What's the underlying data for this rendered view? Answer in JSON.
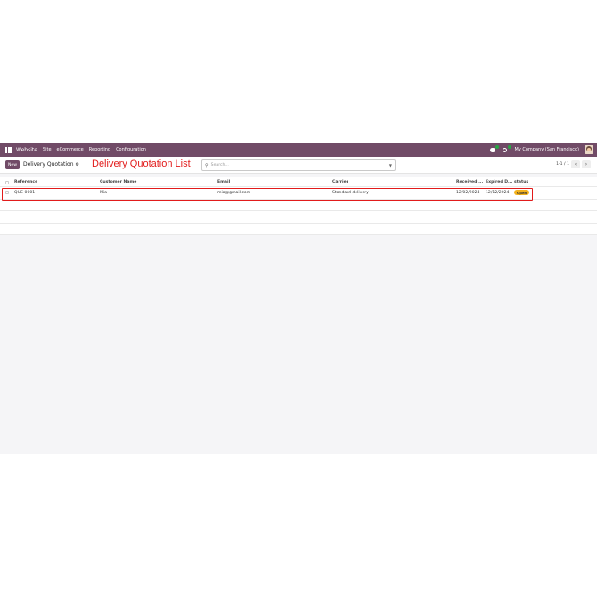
{
  "navbar": {
    "brand": "Website",
    "menu": [
      "Site",
      "eCommerce",
      "Reporting",
      "Configuration"
    ],
    "company": "My Company (San Francisco)"
  },
  "control": {
    "new_label": "New",
    "breadcrumb": "Delivery Quotation",
    "annotation": "Delivery Quotation List",
    "search_placeholder": "Search...",
    "pager": "1-1 / 1"
  },
  "table": {
    "columns": [
      "Reference",
      "Customer Name",
      "Email",
      "Carrier",
      "Received ...",
      "Expired D...",
      "status"
    ],
    "rows": [
      {
        "reference": "QUE-0001",
        "customer": "Mia",
        "email": "mia@gmail.com",
        "carrier": "Standard delivery",
        "received": "12/02/2024",
        "expired": "12/12/2024",
        "status": "Open"
      }
    ]
  },
  "colors": {
    "navbar": "#714b67",
    "annotation": "#e21b1b",
    "status_open": "#f3b21c"
  }
}
